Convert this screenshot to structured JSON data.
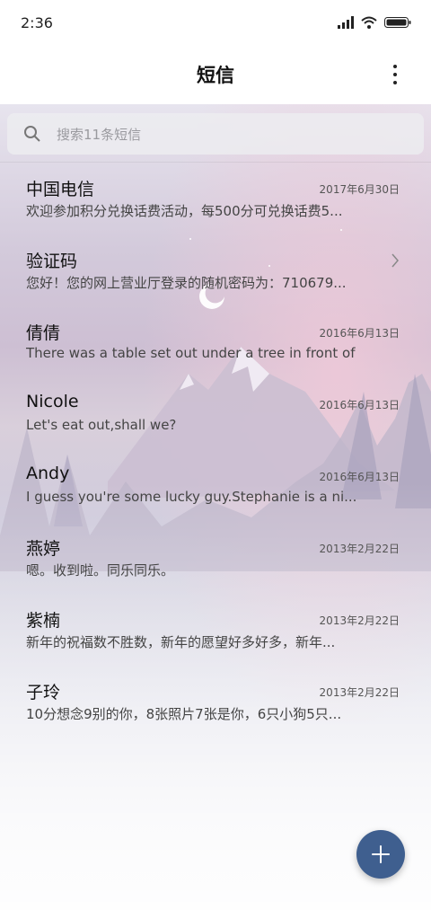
{
  "status_bar": {
    "time": "2:36",
    "icons": [
      "signal-icon",
      "wifi-icon",
      "battery-icon"
    ]
  },
  "header": {
    "title": "短信",
    "more_icon": "more-vertical-icon"
  },
  "search": {
    "placeholder": "搜索11条短信",
    "icon": "search-icon"
  },
  "conversations": [
    {
      "name": "中国电信",
      "date": "2017年6月30日",
      "preview": "欢迎参加积分兑换话费活动，每500分可兑换话费5..."
    },
    {
      "name": "验证码",
      "date": "",
      "preview": "您好！您的网上营业厅登录的随机密码为：710679...",
      "chevron": "chevron-right-icon"
    },
    {
      "name": "倩倩",
      "date": "2016年6月13日",
      "preview": "There was a table set out under a tree in front of ..."
    },
    {
      "name": "Nicole",
      "date": "2016年6月13日",
      "preview": "Let's eat out,shall we?"
    },
    {
      "name": "Andy",
      "date": "2016年6月13日",
      "preview": "I guess you're some lucky guy.Stephanie is a ni..."
    },
    {
      "name": "燕婷",
      "date": "2013年2月22日",
      "preview": "嗯。收到啦。同乐同乐。"
    },
    {
      "name": "紫楠",
      "date": "2013年2月22日",
      "preview": "新年的祝福数不胜数，新年的愿望好多好多，新年..."
    },
    {
      "name": "子玲",
      "date": "2013年2月22日",
      "preview": "10分想念9别的你，8张照片7张是你，6只小狗5只..."
    }
  ],
  "fab": {
    "icon": "plus-icon",
    "color": "#3f5f8f"
  }
}
